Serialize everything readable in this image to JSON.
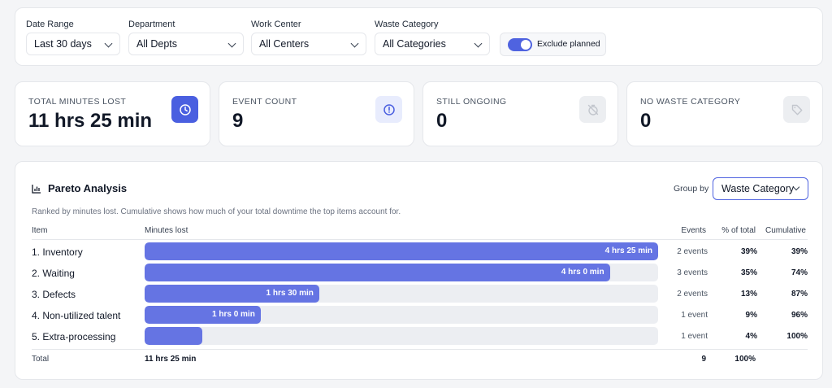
{
  "filters": {
    "date_range": {
      "label": "Date Range",
      "value": "Last 30 days"
    },
    "department": {
      "label": "Department",
      "value": "All Depts"
    },
    "work_center": {
      "label": "Work Center",
      "value": "All Centers"
    },
    "waste_category": {
      "label": "Waste Category",
      "value": "All Categories"
    },
    "exclude_planned": {
      "label": "Exclude planned",
      "on": true
    }
  },
  "stats": [
    {
      "label": "TOTAL MINUTES LOST",
      "value": "11 hrs 25 min",
      "icon": "clock-icon"
    },
    {
      "label": "EVENT COUNT",
      "value": "9",
      "icon": "alert-circle-icon"
    },
    {
      "label": "STILL ONGOING",
      "value": "0",
      "icon": "timer-off-icon"
    },
    {
      "label": "NO WASTE CATEGORY",
      "value": "0",
      "icon": "tag-icon"
    }
  ],
  "pareto": {
    "title": "Pareto Analysis",
    "description": "Ranked by minutes lost. Cumulative shows how much of your total downtime the top items account for.",
    "group_by_label": "Group by",
    "group_by_value": "Waste Category",
    "columns": {
      "item": "Item",
      "minutes": "Minutes lost",
      "events": "Events",
      "pct": "% of total",
      "cumulative": "Cumulative"
    },
    "rows": [
      {
        "item": "1. Inventory",
        "minutes_label": "4 hrs 25 min",
        "fraction": 1.0,
        "events": "2 events",
        "pct": "39%",
        "cumulative": "39%"
      },
      {
        "item": "2. Waiting",
        "minutes_label": "4 hrs 0 min",
        "fraction": 0.906,
        "events": "3 events",
        "pct": "35%",
        "cumulative": "74%"
      },
      {
        "item": "3. Defects",
        "minutes_label": "1 hrs 30 min",
        "fraction": 0.34,
        "events": "2 events",
        "pct": "13%",
        "cumulative": "87%"
      },
      {
        "item": "4. Non-utilized talent",
        "minutes_label": "1 hrs 0 min",
        "fraction": 0.226,
        "events": "1 event",
        "pct": "9%",
        "cumulative": "96%"
      },
      {
        "item": "5. Extra-processing",
        "minutes_label": "",
        "fraction": 0.113,
        "events": "1 event",
        "pct": "4%",
        "cumulative": "100%"
      }
    ],
    "total": {
      "label": "Total",
      "minutes": "11 hrs 25 min",
      "events": "9",
      "pct": "100%"
    }
  },
  "colors": {
    "accent": "#4f63e0",
    "bar": "#6574e3",
    "track": "#eceef2"
  }
}
